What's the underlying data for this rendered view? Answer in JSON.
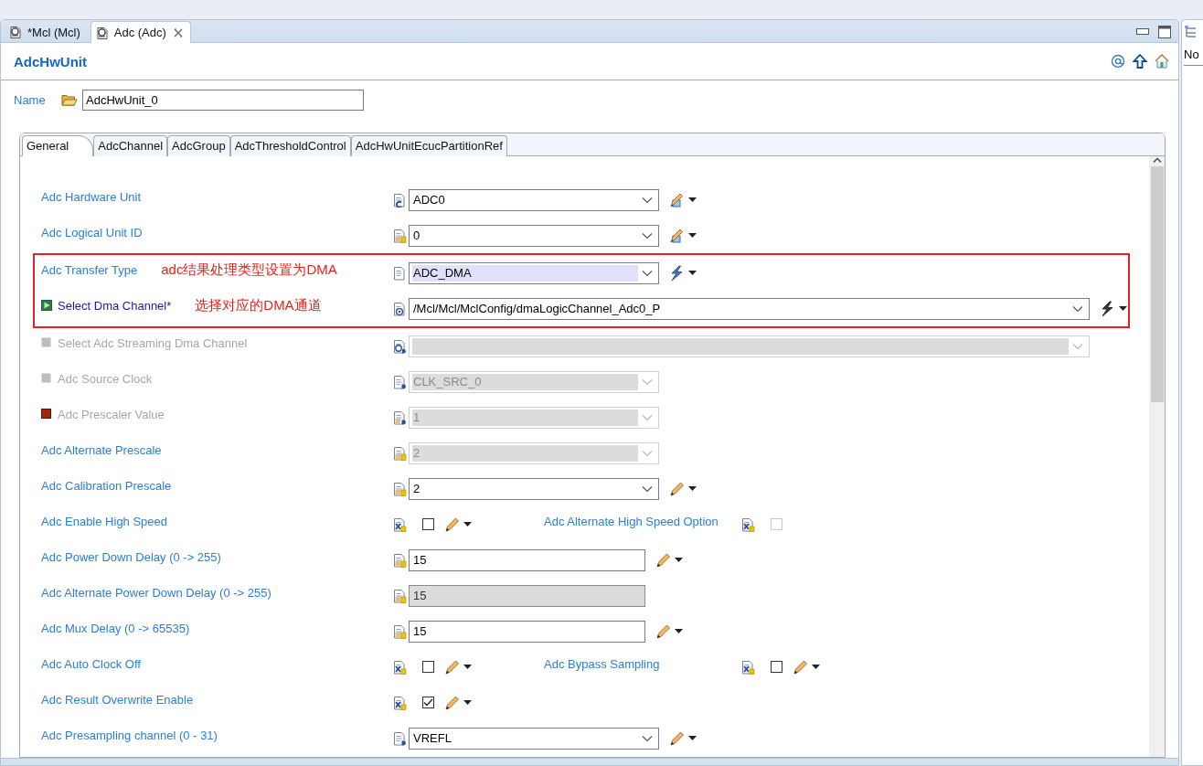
{
  "editor_tabs": [
    {
      "label": "*Mcl (Mcl)",
      "selected": false,
      "closable": false
    },
    {
      "label": "Adc (Adc)",
      "selected": true,
      "closable": true
    }
  ],
  "page": {
    "title": "AdcHwUnit"
  },
  "name_field": {
    "label": "Name",
    "value": "AdcHwUnit_0"
  },
  "tabs": [
    {
      "label": "General",
      "selected": true
    },
    {
      "label": "AdcChannel",
      "selected": false
    },
    {
      "label": "AdcGroup",
      "selected": false
    },
    {
      "label": "AdcThresholdControl",
      "selected": false
    },
    {
      "label": "AdcHwUnitEcucPartitionRef",
      "selected": false
    }
  ],
  "rows": [
    {
      "kind": "combo",
      "label": "Adc Hardware Unit",
      "type_icon": {
        "kind": "enum"
      },
      "value": "ADC0",
      "disabled": false,
      "action_button": {
        "kind": "ruler-pencil"
      }
    },
    {
      "kind": "combo",
      "label": "Adc Logical Unit ID",
      "type_icon": {
        "kind": "integer"
      },
      "value": "0",
      "disabled": false,
      "action_button": {
        "kind": "ruler-pencil"
      }
    },
    {
      "kind": "combo",
      "label": "Adc Transfer Type",
      "note": "adc结果处理类型设置为DMA",
      "framed": true,
      "type_icon": {
        "kind": "text"
      },
      "value": "ADC_DMA",
      "highlighted": true,
      "disabled": false,
      "action_button": {
        "kind": "lightning-blue"
      }
    },
    {
      "kind": "combo",
      "label": "Select Dma Channel*",
      "note": "选择对应的DMA通道",
      "framed": true,
      "marker": {
        "kind": "enabled"
      },
      "type_icon": {
        "kind": "reference"
      },
      "value": "/Mcl/Mcl/MclConfig/dmaLogicChannel_Adc0_P",
      "wide": true,
      "disabled": false,
      "action_button": {
        "kind": "lightning-dark"
      }
    },
    {
      "kind": "combo",
      "label": "Select Adc Streaming Dma Channel",
      "marker": {
        "kind": "disabled"
      },
      "inactive": true,
      "type_icon": {
        "kind": "reference-derived"
      },
      "wide": true,
      "disabled": true
    },
    {
      "kind": "combo",
      "label": "Adc Source Clock",
      "marker": {
        "kind": "disabled"
      },
      "inactive": true,
      "type_icon": {
        "kind": "enum-derived"
      },
      "value": "CLK_SRC_0",
      "disabled": true
    },
    {
      "kind": "combo",
      "label": "Adc Prescaler Value",
      "marker": {
        "kind": "error"
      },
      "inactive": true,
      "type_icon": {
        "kind": "integer-derived"
      },
      "value": "1",
      "disabled": true
    },
    {
      "kind": "combo",
      "label": "Adc Alternate Prescale",
      "type_icon": {
        "kind": "integer"
      },
      "value": "2",
      "disabled": true
    },
    {
      "kind": "combo",
      "label": "Adc Calibration Prescale",
      "type_icon": {
        "kind": "integer"
      },
      "value": "2",
      "disabled": false,
      "action_button": {
        "kind": "pencil"
      }
    },
    {
      "kind": "check",
      "label": "Adc Enable High Speed",
      "type_icon": {
        "kind": "boolean"
      },
      "checked": false,
      "disabled": false,
      "action_button": {
        "kind": "pencil"
      },
      "companion": {
        "label": "Adc Alternate High Speed Option",
        "type_icon": {
          "kind": "boolean"
        },
        "checked": false,
        "disabled": true
      }
    },
    {
      "kind": "text",
      "label": "Adc Power Down Delay (0 -> 255)",
      "type_icon": {
        "kind": "integer"
      },
      "value": "15",
      "disabled": false,
      "action_button": {
        "kind": "pencil"
      }
    },
    {
      "kind": "text",
      "label": "Adc Alternate Power Down Delay (0 -> 255)",
      "type_icon": {
        "kind": "integer"
      },
      "value": "15",
      "disabled": true
    },
    {
      "kind": "text",
      "label": "Adc Mux Delay (0 -> 65535)",
      "type_icon": {
        "kind": "integer"
      },
      "value": "15",
      "disabled": false,
      "action_button": {
        "kind": "pencil"
      }
    },
    {
      "kind": "check",
      "label": "Adc Auto Clock Off",
      "type_icon": {
        "kind": "boolean"
      },
      "checked": false,
      "disabled": false,
      "action_button": {
        "kind": "pencil"
      },
      "companion": {
        "label": "Adc Bypass Sampling",
        "type_icon": {
          "kind": "boolean"
        },
        "checked": false,
        "disabled": false,
        "action_button": {
          "kind": "pencil"
        }
      }
    },
    {
      "kind": "check",
      "label": "Adc Result Overwrite Enable",
      "type_icon": {
        "kind": "boolean"
      },
      "checked": true,
      "disabled": false,
      "action_button": {
        "kind": "pencil"
      }
    },
    {
      "kind": "combo",
      "label": "Adc Presampling channel (0 - 31)",
      "type_icon": {
        "kind": "enum-derived"
      },
      "value": "VREFL",
      "disabled": false,
      "action_button": {
        "kind": "pencil"
      }
    }
  ],
  "side_panel": {
    "heading": "No"
  }
}
